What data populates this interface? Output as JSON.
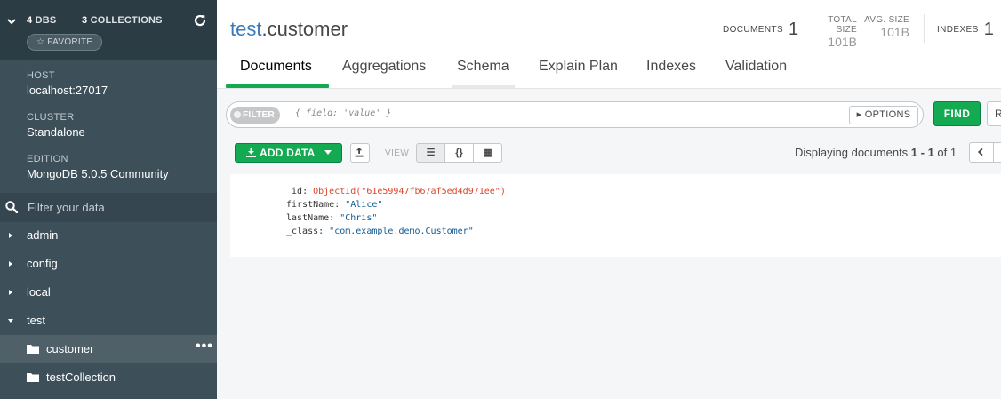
{
  "sidebar": {
    "db_count": "4",
    "db_label": "DBS",
    "coll_count": "3",
    "coll_label": "COLLECTIONS",
    "favorite": "FAVORITE",
    "host_label": "HOST",
    "host_value": "localhost:27017",
    "cluster_label": "CLUSTER",
    "cluster_value": "Standalone",
    "edition_label": "EDITION",
    "edition_value": "MongoDB 5.0.5 Community",
    "filter_placeholder": "Filter your data",
    "databases": [
      {
        "name": "admin",
        "expanded": false
      },
      {
        "name": "config",
        "expanded": false
      },
      {
        "name": "local",
        "expanded": false
      },
      {
        "name": "test",
        "expanded": true
      }
    ],
    "collections": [
      {
        "name": "customer",
        "active": true
      },
      {
        "name": "testCollection",
        "active": false
      }
    ],
    "more_glyph": "•••"
  },
  "header": {
    "ns_db": "test",
    "ns_coll": ".customer",
    "documents_label": "DOCUMENTS",
    "documents_value": "1",
    "total_size_label": "TOTAL SIZE",
    "total_size_value": "101B",
    "avg_size_label": "AVG. SIZE",
    "avg_size_value": "101B",
    "indexes_label": "INDEXES",
    "indexes_value": "1"
  },
  "tabs": [
    "Documents",
    "Aggregations",
    "Schema",
    "Explain Plan",
    "Indexes",
    "Validation"
  ],
  "query": {
    "filter_label": "FILTER",
    "placeholder": "{ field: 'value' }",
    "options_label": "OPTIONS",
    "find_label": "FIND",
    "reset_label": "R"
  },
  "toolbar": {
    "add_data_label": "ADD DATA",
    "view_label": "VIEW",
    "view_list_glyph": "☰",
    "view_json_glyph": "{}",
    "view_table_glyph": "▦",
    "paging_prefix": "Displaying documents ",
    "paging_range": "1 - 1",
    "paging_of": " of 1"
  },
  "document": {
    "fields": [
      {
        "key": "_id",
        "value": "ObjectId(\"61e59947fb67af5ed4d971ee\")",
        "type": "oid"
      },
      {
        "key": "firstName",
        "value": "\"Alice\"",
        "type": "str"
      },
      {
        "key": "lastName",
        "value": "\"Chris\"",
        "type": "str"
      },
      {
        "key": "_class",
        "value": "\"com.example.demo.Customer\"",
        "type": "str"
      }
    ]
  },
  "colors": {
    "sidebar_bg": "#3d4f58",
    "sidebar_top_bg": "#2b3c45",
    "accent_green": "#13aa52",
    "namespace_blue": "#3a7ab8",
    "objectid_red": "#d8472c",
    "string_blue": "#145a90"
  }
}
